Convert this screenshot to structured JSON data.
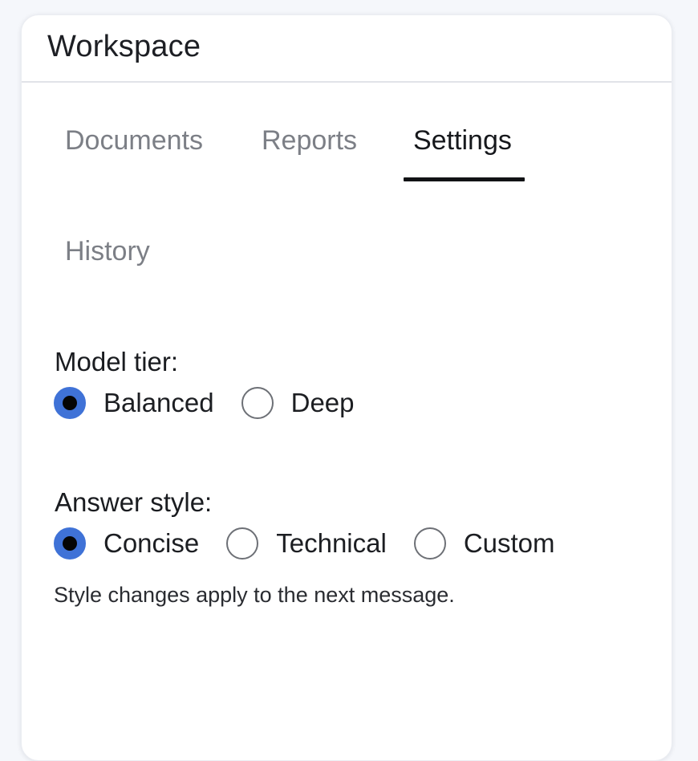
{
  "panel": {
    "title": "Workspace"
  },
  "tabs": [
    {
      "label": "Documents",
      "active": false
    },
    {
      "label": "Reports",
      "active": false
    },
    {
      "label": "Settings",
      "active": true
    },
    {
      "label": "History",
      "active": false
    }
  ],
  "model_tier": {
    "label": "Model tier:",
    "options": [
      {
        "label": "Balanced",
        "selected": true
      },
      {
        "label": "Deep",
        "selected": false
      }
    ]
  },
  "answer_style": {
    "label": "Answer style:",
    "options": [
      {
        "label": "Concise",
        "selected": true
      },
      {
        "label": "Technical",
        "selected": false
      },
      {
        "label": "Custom",
        "selected": false
      }
    ],
    "hint": "Style changes apply to the next message."
  },
  "colors": {
    "accent": "#3f72d7",
    "active_tab_underline": "#111215",
    "inactive_tab_text": "#7c7f86"
  }
}
